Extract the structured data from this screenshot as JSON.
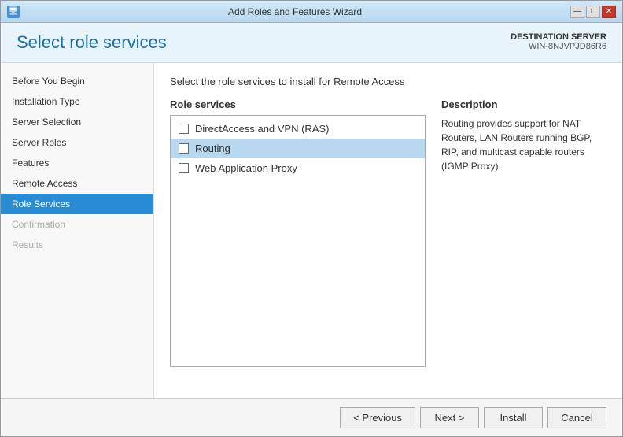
{
  "window": {
    "title": "Add Roles and Features Wizard",
    "icon": "🖥"
  },
  "titlebar_controls": {
    "minimize": "—",
    "maximize": "□",
    "close": "✕"
  },
  "header": {
    "page_title": "Select role services",
    "destination_label": "DESTINATION SERVER",
    "destination_server": "WIN-8NJVPJD86R6"
  },
  "sidebar": {
    "items": [
      {
        "id": "before-you-begin",
        "label": "Before You Begin",
        "state": "normal"
      },
      {
        "id": "installation-type",
        "label": "Installation Type",
        "state": "normal"
      },
      {
        "id": "server-selection",
        "label": "Server Selection",
        "state": "normal"
      },
      {
        "id": "server-roles",
        "label": "Server Roles",
        "state": "normal"
      },
      {
        "id": "features",
        "label": "Features",
        "state": "normal"
      },
      {
        "id": "remote-access",
        "label": "Remote Access",
        "state": "normal"
      },
      {
        "id": "role-services",
        "label": "Role Services",
        "state": "active"
      },
      {
        "id": "confirmation",
        "label": "Confirmation",
        "state": "disabled"
      },
      {
        "id": "results",
        "label": "Results",
        "state": "disabled"
      }
    ]
  },
  "main": {
    "instruction": "Select the role services to install for Remote Access",
    "role_services_header": "Role services",
    "services": [
      {
        "id": "directaccess-vpn",
        "label": "DirectAccess and VPN (RAS)",
        "checked": false,
        "selected": false
      },
      {
        "id": "routing",
        "label": "Routing",
        "checked": false,
        "selected": true
      },
      {
        "id": "web-app-proxy",
        "label": "Web Application Proxy",
        "checked": false,
        "selected": false
      }
    ],
    "description_header": "Description",
    "description_text": "Routing provides support for NAT Routers, LAN Routers running BGP, RIP, and multicast capable routers (IGMP Proxy)."
  },
  "footer": {
    "previous_label": "< Previous",
    "next_label": "Next >",
    "install_label": "Install",
    "cancel_label": "Cancel"
  }
}
